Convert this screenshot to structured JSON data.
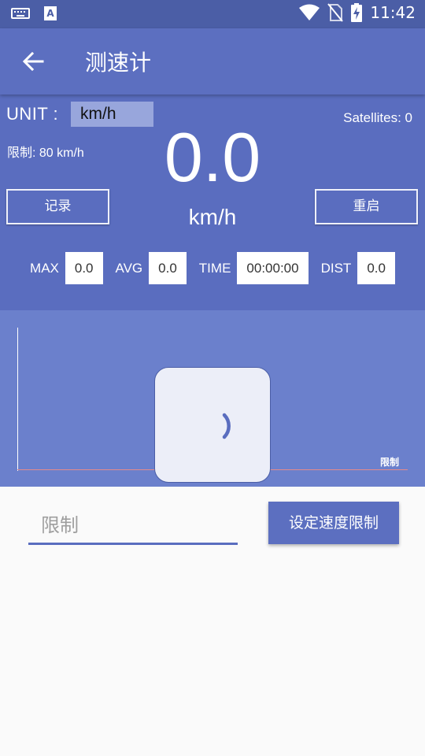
{
  "status_bar": {
    "time": "11:42"
  },
  "app_bar": {
    "title": "测速计"
  },
  "panel": {
    "unit_label": "UNIT :",
    "unit_value": "km/h",
    "satellites": "Satellites: 0",
    "limit_text": "限制: 80 km/h",
    "speed": "0.0",
    "speed_unit": "km/h",
    "record_button": "记录",
    "restart_button": "重启",
    "stats": {
      "max_label": "MAX",
      "max_value": "0.0",
      "avg_label": "AVG",
      "avg_value": "0.0",
      "time_label": "TIME",
      "time_value": "00:00:00",
      "dist_label": "DIST",
      "dist_value": "0.0"
    }
  },
  "chart": {
    "limit_line_label": "限制"
  },
  "form": {
    "limit_placeholder": "限制",
    "set_limit_button": "设定速度限制"
  },
  "colors": {
    "status_bar": "#4b5ea6",
    "app_bar": "#5c6fc0",
    "panel": "#5a6dbf",
    "chart_bg": "#6b80cc",
    "limit_line": "#e58a8a"
  }
}
